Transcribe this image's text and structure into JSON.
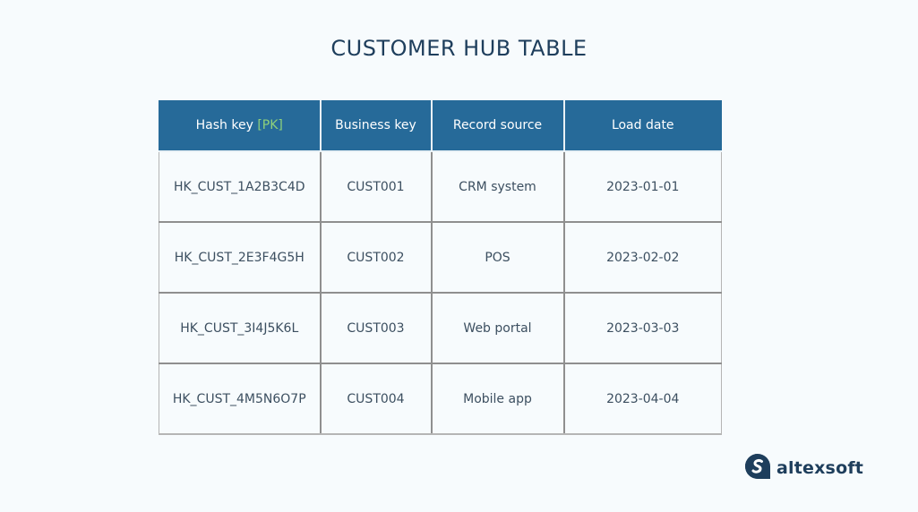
{
  "title": "CUSTOMER HUB TABLE",
  "table": {
    "headers": [
      {
        "label": "Hash key",
        "badge": "[PK]"
      },
      {
        "label": "Business key"
      },
      {
        "label": "Record source"
      },
      {
        "label": "Load date"
      }
    ],
    "rows": [
      [
        "HK_CUST_1A2B3C4D",
        "CUST001",
        "CRM system",
        "2023-01-01"
      ],
      [
        "HK_CUST_2E3F4G5H",
        "CUST002",
        "POS",
        "2023-02-02"
      ],
      [
        "HK_CUST_3I4J5K6L",
        "CUST003",
        "Web portal",
        "2023-03-03"
      ],
      [
        "HK_CUST_4M5N6O7P",
        "CUST004",
        "Mobile app",
        "2023-04-04"
      ]
    ]
  },
  "colors": {
    "header_bg": "#266a99",
    "pk_accent": "#8fd17b",
    "title": "#1e3e5c"
  },
  "logo": {
    "icon": "altexsoft-logo-icon",
    "text": "altexsoft"
  }
}
